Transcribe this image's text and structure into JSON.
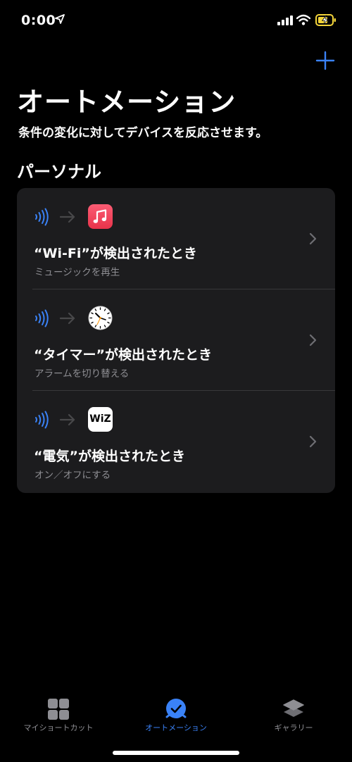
{
  "status_bar": {
    "time": "0:00"
  },
  "header": {
    "title": "オートメーション",
    "subtitle": "条件の変化に対してデバイスを反応させます。"
  },
  "section": {
    "heading": "パーソナル"
  },
  "automations": [
    {
      "title": "“Wi-Fi”が検出されたとき",
      "subtitle": "ミュージックを再生",
      "app_icon": "music-app-icon"
    },
    {
      "title": "“タイマー”が検出されたとき",
      "subtitle": "アラームを切り替える",
      "app_icon": "clock-app-icon"
    },
    {
      "title": "“電気”が検出されたとき",
      "subtitle": "オン／オフにする",
      "app_icon": "wiz-app-icon",
      "app_icon_text": "WiZ"
    }
  ],
  "tabs": [
    {
      "label": "マイショートカット",
      "icon": "grid-icon"
    },
    {
      "label": "オートメーション",
      "icon": "automation-clock-icon",
      "active": true
    },
    {
      "label": "ギャラリー",
      "icon": "layers-icon"
    }
  ],
  "colors": {
    "accent": "#3a82f7",
    "background": "#000000",
    "card": "#1c1c1e",
    "secondary_text": "#8e8e93",
    "battery": "#f4d53a"
  }
}
